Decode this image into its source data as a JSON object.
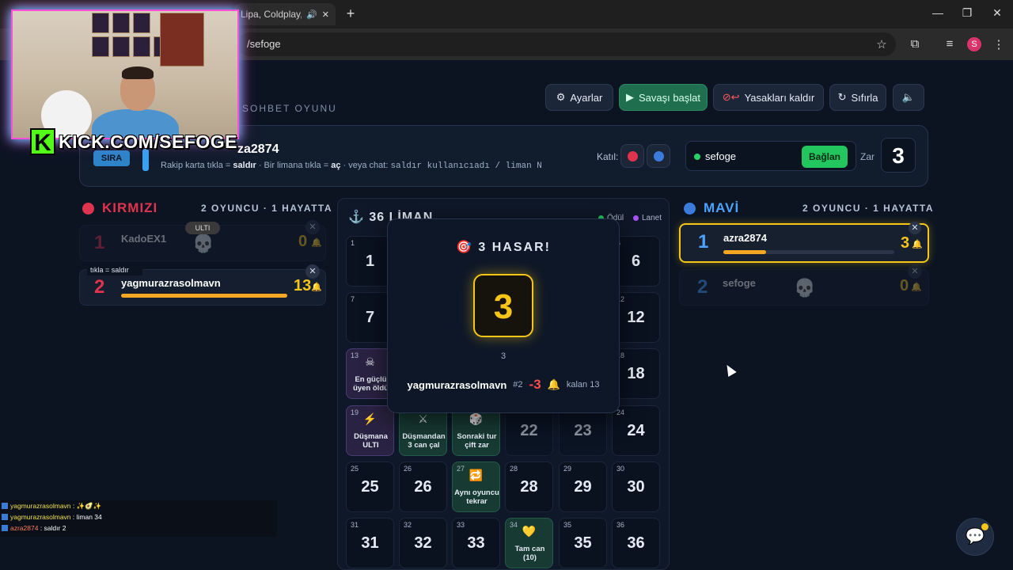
{
  "browser": {
    "tab_title": "Lipa, Coldplay, M",
    "url": "/sefoge"
  },
  "stream": {
    "kick_url": "KICK.COM/SEFOGE"
  },
  "app": {
    "subtitle": "SOHBET OYUNU",
    "buttons": {
      "settings": "Ayarlar",
      "start_battle": "Savaşı başlat",
      "remove_bans": "Yasakları kaldır",
      "reset": "Sıfırla"
    },
    "turn": {
      "badge": "SIRA",
      "current_player": "za2874",
      "hint_prefix": "Rakip karta tıkla = ",
      "hint_attack": "saldır",
      "hint_mid": " · Bir limana tıkla = ",
      "hint_open": "aç",
      "hint_chat": " · veya chat: ",
      "hint_cmd": "saldır kullanıcıadı / liman N"
    },
    "join_label": "Katıl:",
    "channel": {
      "name": "sefoge",
      "connect_label": "Bağlan"
    },
    "dice_label": "Zar",
    "dice_value": "3",
    "colors": {
      "red": "#e0334e",
      "blue": "#3b7bdc",
      "gold": "#f5c518",
      "green": "#22c55e"
    }
  },
  "teams": {
    "red": {
      "name": "KIRMIZI",
      "count": "2 OYUNCU · 1 HAYATTA",
      "players": [
        {
          "num": "1",
          "name": "KadoEX1",
          "value": "0",
          "dead": true,
          "badge": "ULTI"
        },
        {
          "num": "2",
          "name": "yagmurazrasolmavn",
          "value": "13",
          "dead": false,
          "hp": 1.0,
          "tag": "tıkla = saldır"
        }
      ]
    },
    "blue": {
      "name": "MAVİ",
      "count": "2 OYUNCU · 1 HAYATTA",
      "players": [
        {
          "num": "1",
          "name": "azra2874",
          "value": "3",
          "dead": false,
          "hp": 0.23
        },
        {
          "num": "2",
          "name": "sefoge",
          "value": "0",
          "dead": true
        }
      ]
    }
  },
  "board": {
    "title": "36 LİMAN",
    "legend": {
      "reward": "Ödül",
      "curse": "Lanet"
    },
    "cells": [
      {
        "n": "1",
        "big": "1"
      },
      {
        "n": "6",
        "big": "6"
      },
      {
        "n": "7",
        "big": "7"
      },
      {
        "n": "12",
        "big": "12"
      },
      {
        "n": "13",
        "label": "En güçlü üyen öldü",
        "icon": "☠",
        "kind": "curse"
      },
      {
        "n": "18",
        "big": "18"
      },
      {
        "n": "19",
        "label": "Düşmana ULTI",
        "icon": "⚡",
        "kind": "curse"
      },
      {
        "n": "",
        "label": "Düşmandan 3 can çal",
        "icon": "⚔",
        "kind": "reward"
      },
      {
        "n": "",
        "label": "Sonraki tur çift zar",
        "icon": "🎲",
        "kind": "reward"
      },
      {
        "n": "",
        "big": "22"
      },
      {
        "n": "",
        "big": "23"
      },
      {
        "n": "24",
        "big": "24"
      },
      {
        "n": "25",
        "big": "25"
      },
      {
        "n": "26",
        "big": "26"
      },
      {
        "n": "27",
        "label": "Aynı oyuncu tekrar",
        "icon": "🔁",
        "kind": "reward"
      },
      {
        "n": "28",
        "big": "28"
      },
      {
        "n": "29",
        "big": "29"
      },
      {
        "n": "30",
        "big": "30"
      },
      {
        "n": "31",
        "big": "31"
      },
      {
        "n": "32",
        "big": "32"
      },
      {
        "n": "33",
        "big": "33"
      },
      {
        "n": "34",
        "label": "Tam can (10)",
        "icon": "💛",
        "kind": "reward"
      },
      {
        "n": "35",
        "big": "35"
      },
      {
        "n": "36",
        "big": "36"
      }
    ]
  },
  "modal": {
    "title": "3 HASAR!",
    "dice": "3",
    "dice_sub": "3",
    "attacker": "yagmurazrasolmavn",
    "rank": "#2",
    "damage": "-3",
    "remaining": "kalan 13"
  },
  "chat": [
    {
      "user": "yagmurazrasolmavn",
      "msg": ": ✨🥑✨"
    },
    {
      "user": "yagmurazrasolmavn",
      "msg": ": liman 34"
    },
    {
      "user": "azra2874",
      "msg": ": saldır 2"
    }
  ]
}
